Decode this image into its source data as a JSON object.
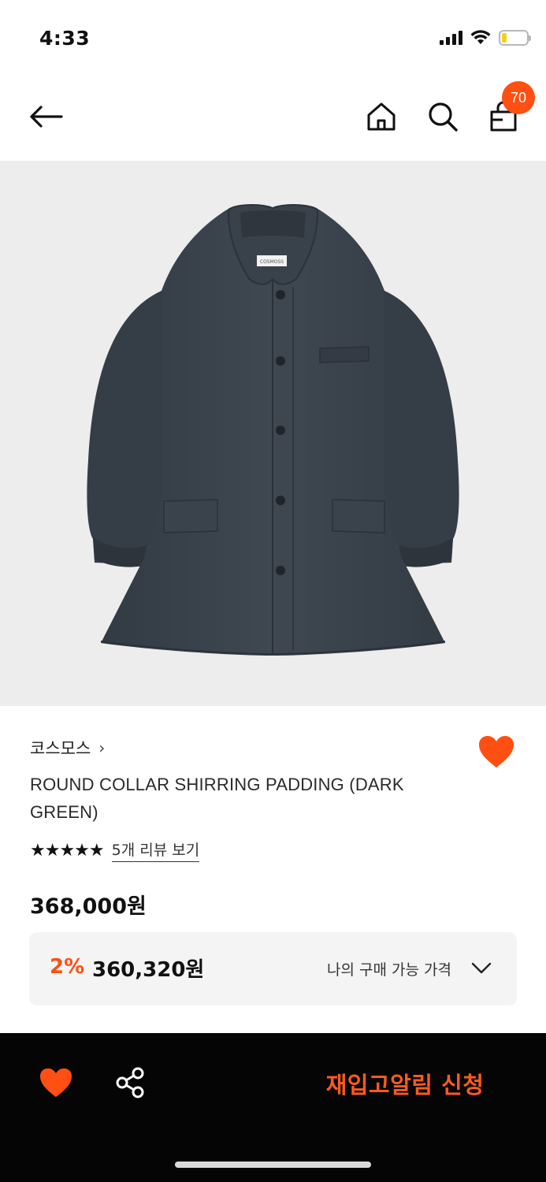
{
  "status_bar": {
    "time": "4:33"
  },
  "nav": {
    "cart_count": "70",
    "icons": [
      "back-arrow-icon",
      "home-icon",
      "search-icon",
      "shopping-bag-icon"
    ]
  },
  "product": {
    "image_alt": "",
    "brand": "코스모스",
    "brand_chevron": "›",
    "name": "ROUND COLLAR SHIRRING PADDING (DARK GREEN)",
    "rating_stars": 5,
    "stars_text": "★★★★★",
    "review_link": "5개 리뷰 보기",
    "price": "368,000원",
    "wishlisted": true
  },
  "my_price": {
    "discount": "2%",
    "price": "360,320원",
    "label": "나의 구매 가능 가격"
  },
  "bottom_bar": {
    "restock_label": "재입고알림 신청"
  },
  "colors": {
    "accent": "#ff4f12",
    "bottom_bar_bg": "#050505",
    "image_bg": "#ededed",
    "jacket": "#3a424c"
  }
}
